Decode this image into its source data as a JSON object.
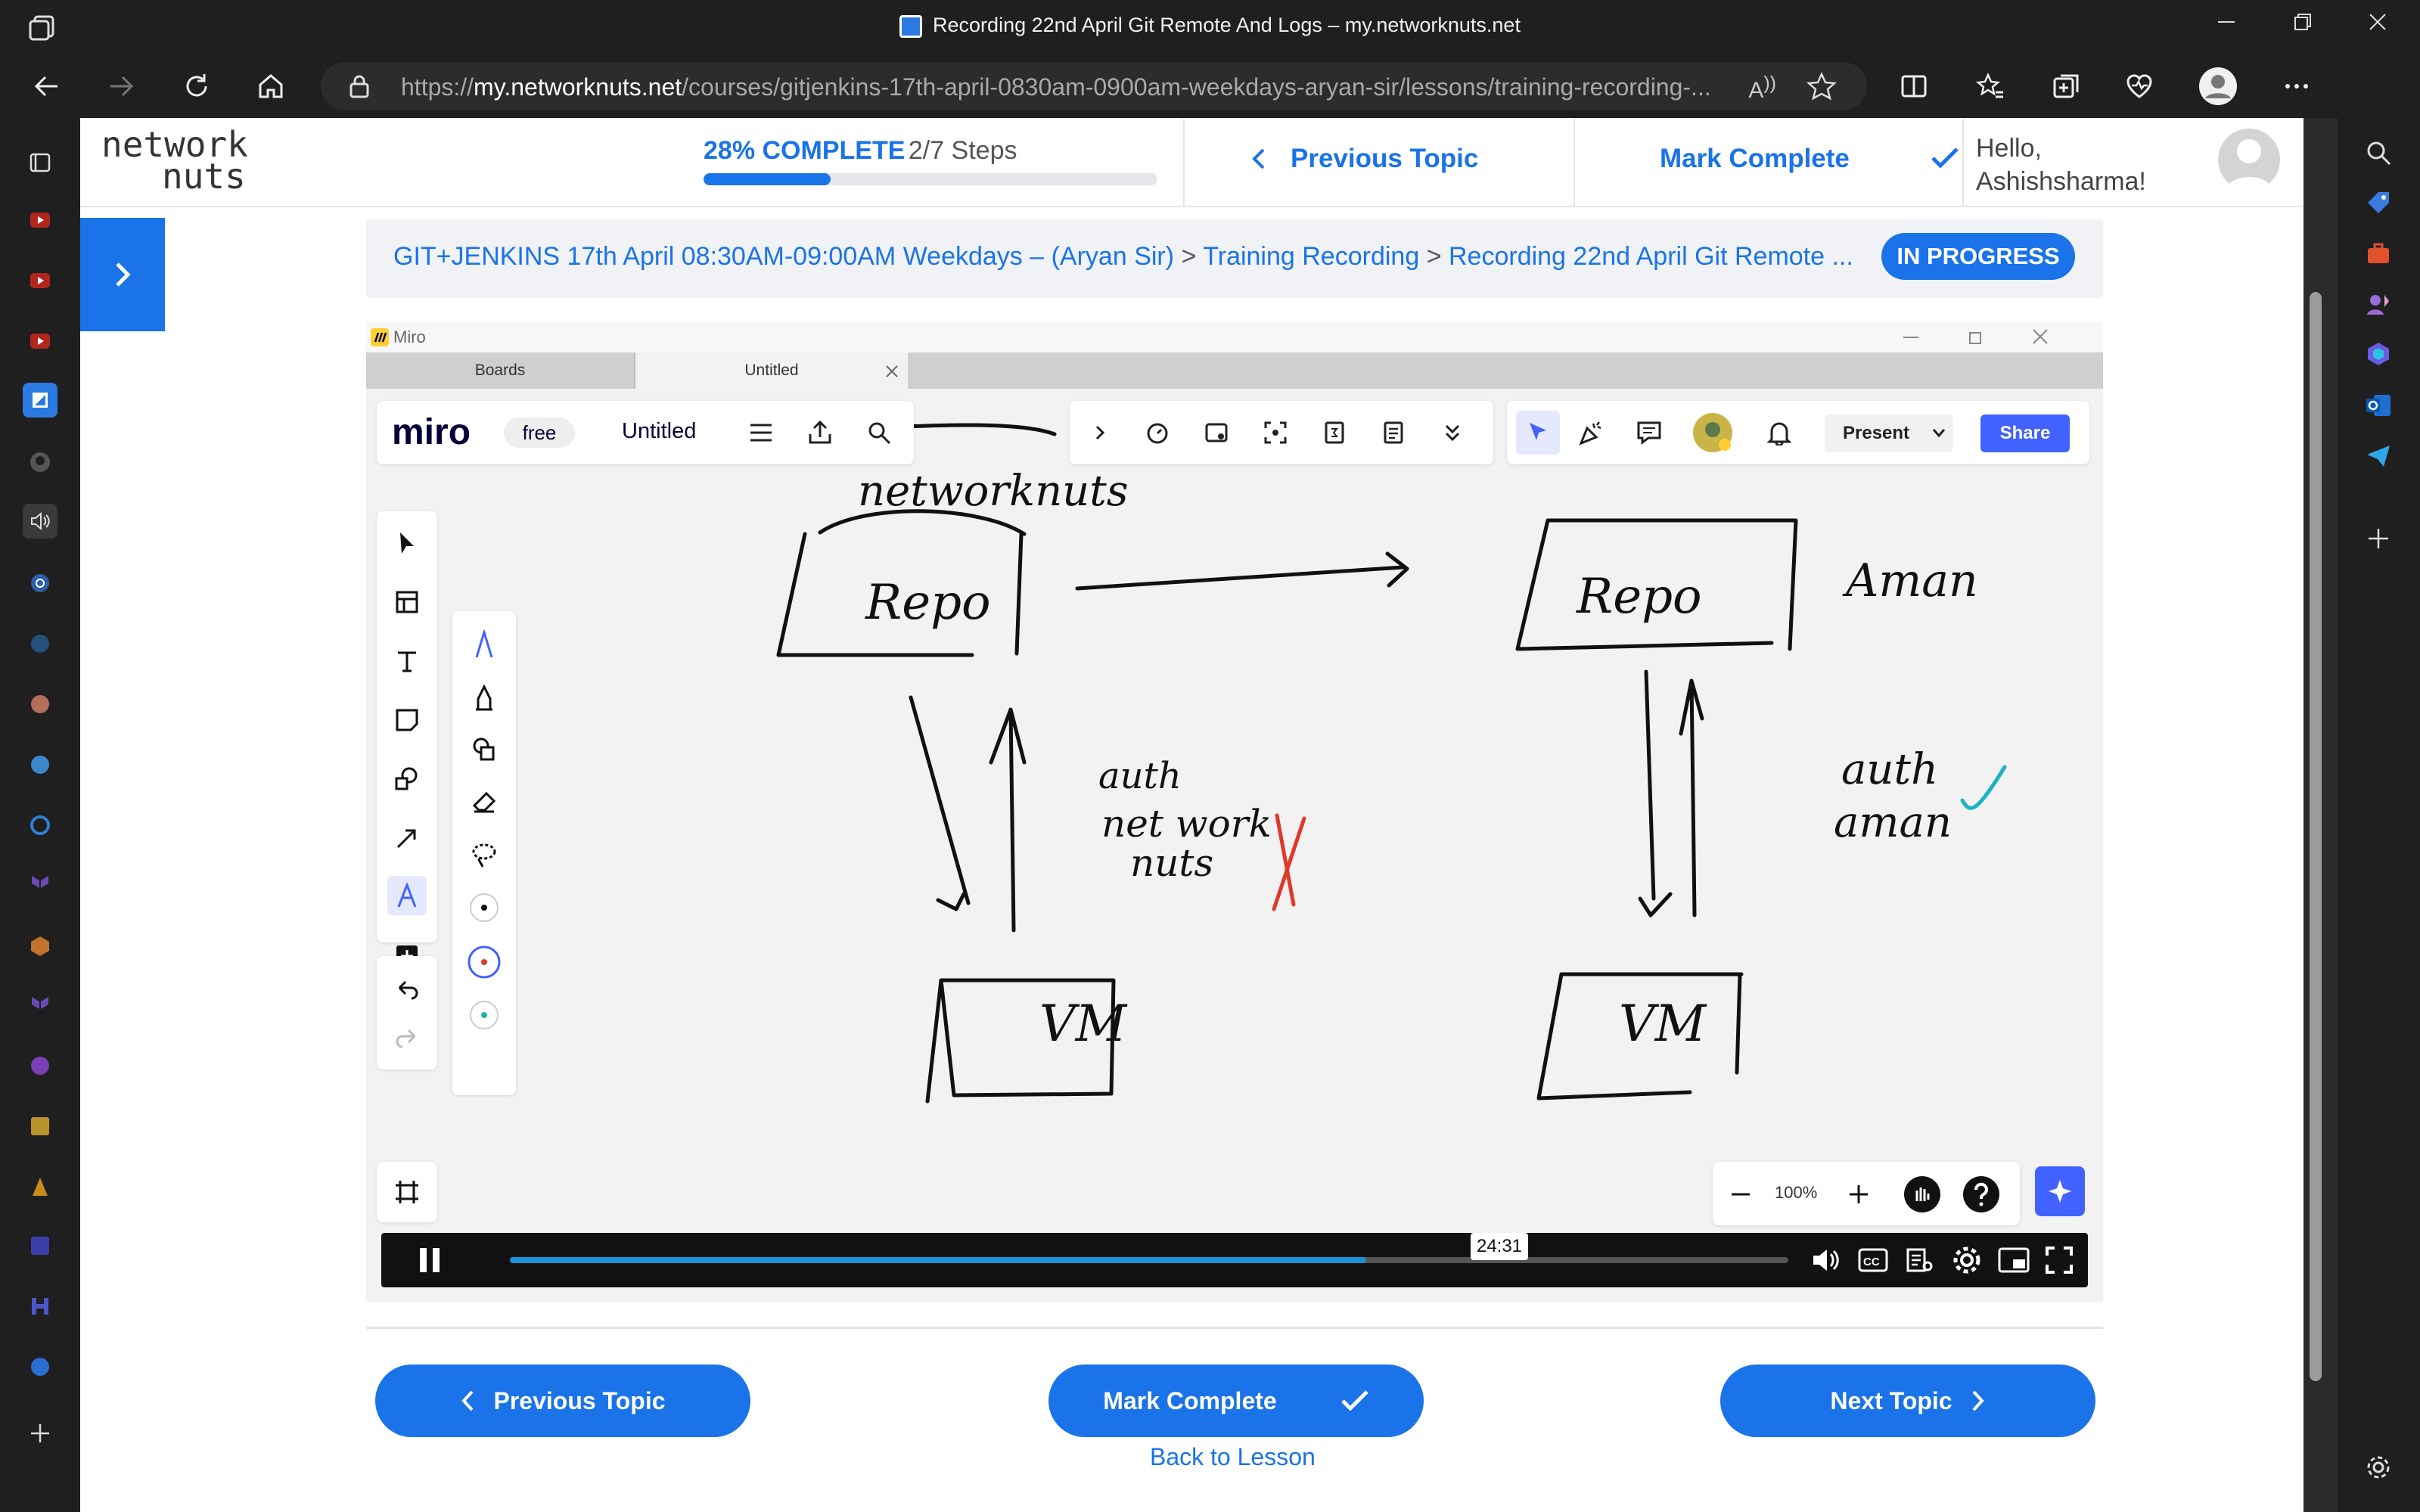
{
  "window": {
    "title": "Recording 22nd April Git Remote And Logs – my.networknuts.net"
  },
  "address_bar": {
    "url_prefix": "https://",
    "url_domain": "my.networknuts.net",
    "url_path": "/courses/gitjenkins-17th-april-0830am-0900am-weekdays-aryan-sir/lessons/training-recording-..."
  },
  "site": {
    "logo_text_line1": "network",
    "logo_text_line2": "nuts",
    "progress_percent_label": "28% COMPLETE",
    "progress_steps": "2/7 Steps",
    "progress_fraction": 0.28,
    "previous_topic": "Previous Topic",
    "mark_complete": "Mark Complete",
    "greeting": "Hello,",
    "username": "Ashishsharma!"
  },
  "breadcrumb": {
    "course": "GIT+JENKINS 17th April 08:30AM-09:00AM Weekdays – (Aryan Sir)",
    "section": "Training Recording",
    "lesson": "Recording 22nd April Git Remote ...",
    "separator": ">",
    "status": "IN PROGRESS"
  },
  "video": {
    "miro_window_title": "Miro",
    "tabs": [
      "Boards",
      "Untitled"
    ],
    "miro_logo": "miro",
    "plan_badge": "free",
    "board_title": "Untitled",
    "present_label": "Present",
    "share_label": "Share",
    "zoom_level": "100%",
    "timestamp": "24:31",
    "played_fraction": 0.67,
    "whiteboard": {
      "title_note": "networknuts",
      "left_repo": "Repo",
      "right_repo": "Repo",
      "right_owner": "Aman",
      "left_vm": "VM",
      "right_vm": "VM",
      "left_auth": [
        "auth",
        "net work",
        "nuts"
      ],
      "right_auth": [
        "auth",
        "aman"
      ]
    }
  },
  "footer_nav": {
    "previous": "Previous Topic",
    "mark_complete": "Mark Complete",
    "next": "Next Topic",
    "back": "Back to Lesson"
  },
  "colors": {
    "accent": "#1a73e8",
    "miro_share": "#4262ff",
    "cross": "#e0392b",
    "check": "#1bb3c4"
  }
}
